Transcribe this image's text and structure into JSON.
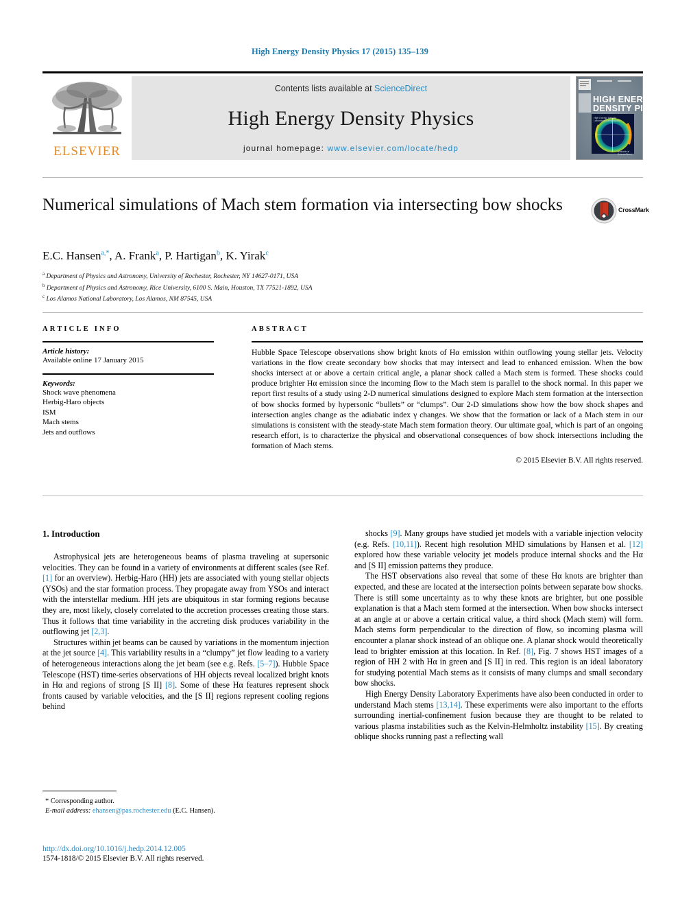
{
  "running_head": "High Energy Density Physics 17 (2015) 135–139",
  "banner": {
    "publisher": "ELSEVIER",
    "contents_prefix": "Contents lists available at",
    "contents_link": "ScienceDirect",
    "journal_name": "High Energy Density Physics",
    "homepage_prefix": "journal homepage:",
    "homepage_url": "www.elsevier.com/locate/hedp",
    "cover_title_line1": "HIGH ENERGY",
    "cover_title_line2": "DENSITY PHYSICS"
  },
  "article": {
    "title": "Numerical simulations of Mach stem formation via intersecting bow shocks",
    "crossmark_label": "CrossMark",
    "authors": "E.C. Hansen a,*, A. Frank a, P. Hartigan b, K. Yirak c",
    "author_list": [
      {
        "name": "E.C. Hansen",
        "marks": "a,*"
      },
      {
        "name": "A. Frank",
        "marks": "a"
      },
      {
        "name": "P. Hartigan",
        "marks": "b"
      },
      {
        "name": "K. Yirak",
        "marks": "c"
      }
    ],
    "affiliations": [
      {
        "mark": "a",
        "text": "Department of Physics and Astronomy, University of Rochester, Rochester, NY 14627-0171, USA"
      },
      {
        "mark": "b",
        "text": "Department of Physics and Astronomy, Rice University, 6100 S. Main, Houston, TX 77521-1892, USA"
      },
      {
        "mark": "c",
        "text": "Los Alamos National Laboratory, Los Alamos, NM 87545, USA"
      }
    ]
  },
  "info": {
    "heading": "ARTICLE INFO",
    "history_label": "Article history:",
    "history_value": "Available online 17 January 2015",
    "keywords_label": "Keywords:",
    "keywords": [
      "Shock wave phenomena",
      "Herbig-Haro objects",
      "ISM",
      "Mach stems",
      "Jets and outflows"
    ]
  },
  "abstract": {
    "heading": "ABSTRACT",
    "text": "Hubble Space Telescope observations show bright knots of Hα emission within outflowing young stellar jets. Velocity variations in the flow create secondary bow shocks that may intersect and lead to enhanced emission. When the bow shocks intersect at or above a certain critical angle, a planar shock called a Mach stem is formed. These shocks could produce brighter Hα emission since the incoming flow to the Mach stem is parallel to the shock normal. In this paper we report first results of a study using 2-D numerical simulations designed to explore Mach stem formation at the intersection of bow shocks formed by hypersonic “bullets” or “clumps”. Our 2-D simulations show how the bow shock shapes and intersection angles change as the adiabatic index γ changes. We show that the formation or lack of a Mach stem in our simulations is consistent with the steady-state Mach stem formation theory. Our ultimate goal, which is part of an ongoing research effort, is to characterize the physical and observational consequences of bow shock intersections including the formation of Mach stems.",
    "copyright": "© 2015 Elsevier B.V. All rights reserved."
  },
  "body": {
    "section_heading": "1. Introduction",
    "left_paragraphs": [
      "Astrophysical jets are heterogeneous beams of plasma traveling at supersonic velocities. They can be found in a variety of environments at different scales (see Ref. [1] for an overview). Herbig-Haro (HH) jets are associated with young stellar objects (YSOs) and the star formation process. They propagate away from YSOs and interact with the interstellar medium. HH jets are ubiquitous in star forming regions because they are, most likely, closely correlated to the accretion processes creating those stars. Thus it follows that time variability in the accreting disk produces variability in the outflowing jet [2,3].",
      "Structures within jet beams can be caused by variations in the momentum injection at the jet source [4]. This variability results in a “clumpy” jet flow leading to a variety of heterogeneous interactions along the jet beam (see e.g. Refs. [5–7]). Hubble Space Telescope (HST) time-series observations of HH objects reveal localized bright knots in Hα and regions of strong [S II] [8]. Some of these Hα features represent shock fronts caused by variable velocities, and the [S II] regions represent cooling regions behind"
    ],
    "right_paragraphs": [
      "shocks [9]. Many groups have studied jet models with a variable injection velocity (e.g. Refs. [10,11]). Recent high resolution MHD simulations by Hansen et al. [12] explored how these variable velocity jet models produce internal shocks and the Hα and [S II] emission patterns they produce.",
      "The HST observations also reveal that some of these Hα knots are brighter than expected, and these are located at the intersection points between separate bow shocks. There is still some uncertainty as to why these knots are brighter, but one possible explanation is that a Mach stem formed at the intersection. When bow shocks intersect at an angle at or above a certain critical value, a third shock (Mach stem) will form. Mach stems form perpendicular to the direction of flow, so incoming plasma will encounter a planar shock instead of an oblique one. A planar shock would theoretically lead to brighter emission at this location. In Ref. [8], Fig. 7 shows HST images of a region of HH 2 with Hα in green and [S II] in red. This region is an ideal laboratory for studying potential Mach stems as it consists of many clumps and small secondary bow shocks.",
      "High Energy Density Laboratory Experiments have also been conducted in order to understand Mach stems [13,14]. These experiments were also important to the efforts surrounding inertial-confinement fusion because they are thought to be related to various plasma instabilities such as the Kelvin-Helmholtz instability [15]. By creating oblique shocks running past a reflecting wall"
    ]
  },
  "footnote": {
    "corresponding": "* Corresponding author.",
    "email_label": "E-mail address:",
    "email": "ehansen@pas.rochester.edu",
    "email_suffix": "(E.C. Hansen)."
  },
  "footer": {
    "doi": "http://dx.doi.org/10.1016/j.hedp.2014.12.005",
    "issn_line": "1574-1818/© 2015 Elsevier B.V. All rights reserved."
  },
  "colors": {
    "link": "#2a8bc4",
    "running_head": "#1c7cb0",
    "elsevier_orange": "#ec8a1e",
    "banner_gray": "#e4e4e4"
  }
}
